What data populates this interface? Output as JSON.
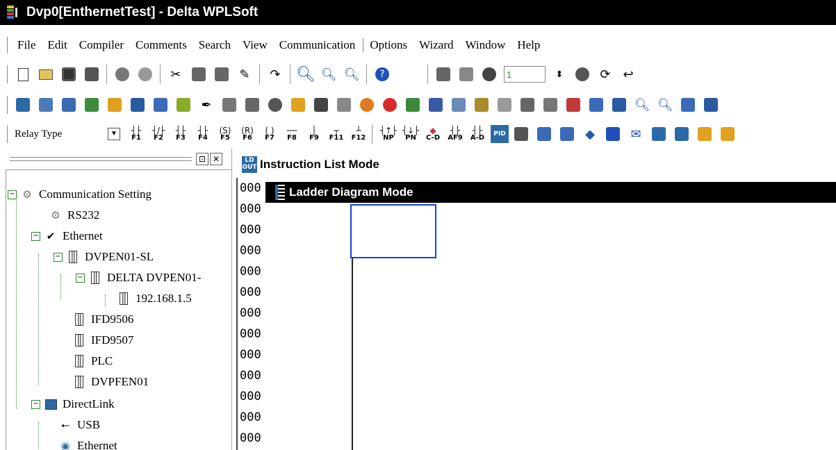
{
  "window": {
    "title": "Dvp0[EnthernetTest] - Delta WPLSoft"
  },
  "menu": [
    "File",
    "Edit",
    "Compiler",
    "Comments",
    "Search",
    "View",
    "Communication",
    "Options",
    "Wizard",
    "Window",
    "Help"
  ],
  "toolbar1": {
    "icons": [
      "new-file-icon",
      "open-folder-icon",
      "save-icon",
      "print-icon",
      "online-icon",
      "offline-icon",
      "cut-icon",
      "copy-icon",
      "paste-icon",
      "eraser-icon",
      "undo-icon",
      "zoom-in-icon",
      "find-icon",
      "find-next-icon",
      "help-icon"
    ],
    "spin_value": "1"
  },
  "toolbar3": {
    "relay_type": "Relay Type",
    "fkeys": [
      "F1",
      "F2",
      "F3",
      "F4",
      "F5",
      "F6",
      "F7",
      "F8",
      "F9",
      "F11",
      "F12"
    ],
    "extra_labels": [
      "NP",
      "PN",
      "C-D",
      "AF9",
      "A-D",
      "PID"
    ]
  },
  "tree": {
    "root": "Communication Setting",
    "rs232": "RS232",
    "ethernet": "Ethernet",
    "dvpen01_sl": "DVPEN01-SL",
    "delta_dvpen01": "DELTA DVPEN01-",
    "ip": "192.168.1.5",
    "ifd9506": "IFD9506",
    "ifd9507": "IFD9507",
    "plc": "PLC",
    "dvpfen01": "DVPFEN01",
    "directlink": "DirectLink",
    "usb": "USB",
    "ethernet2": "Ethernet"
  },
  "instruction_list": {
    "title": "Instruction List Mode",
    "icon_text": "LD OUT",
    "rows": [
      "000",
      "000",
      "000",
      "000",
      "000",
      "000",
      "000",
      "000",
      "000",
      "000",
      "000",
      "000",
      "000"
    ]
  },
  "ladder": {
    "title": "Ladder Diagram Mode"
  },
  "colors": {
    "cursor": "#1a3ad6",
    "tree_lines": "#2a8a2a",
    "titlebar": "#000000"
  }
}
